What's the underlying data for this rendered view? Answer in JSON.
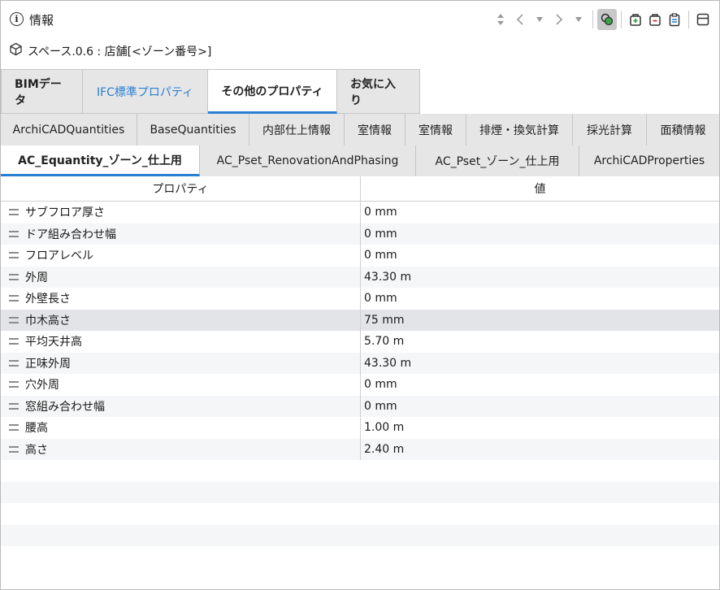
{
  "window": {
    "title": "情報"
  },
  "toolbar": {
    "icons": [
      "up-down-icon",
      "prev-icon",
      "dropdown-icon",
      "next-icon",
      "dropdown-icon",
      "link-settings-icon",
      "add-icon",
      "remove-icon",
      "clipboard-icon",
      "panel-icon"
    ]
  },
  "object": {
    "label": "スペース.0.6 : 店舗[<ゾーン番号>]"
  },
  "tabs_row1": [
    {
      "label": "BIMデータ"
    },
    {
      "label": "IFC標準プロパティ"
    },
    {
      "label": "その他のプロパティ"
    },
    {
      "label": "お気に入り"
    }
  ],
  "tabs_row2": [
    {
      "label": "ArchiCADQuantities"
    },
    {
      "label": "BaseQuantities"
    },
    {
      "label": "内部仕上情報"
    },
    {
      "label": "室情報"
    },
    {
      "label": "室情報"
    },
    {
      "label": "排煙・換気計算"
    },
    {
      "label": "採光計算"
    },
    {
      "label": "面積情報"
    }
  ],
  "tabs_row3": [
    {
      "label": "AC_Equantity_ゾーン_仕上用"
    },
    {
      "label": "AC_Pset_RenovationAndPhasing"
    },
    {
      "label": "AC_Pset_ゾーン_仕上用"
    },
    {
      "label": "ArchiCADProperties"
    }
  ],
  "table": {
    "columns": [
      "プロパティ",
      "値"
    ],
    "rows": [
      {
        "name": "サブフロア厚さ",
        "value": "0 mm"
      },
      {
        "name": "ドア組み合わせ幅",
        "value": "0 mm"
      },
      {
        "name": "フロアレベル",
        "value": "0 mm"
      },
      {
        "name": "外周",
        "value": "43.30 m"
      },
      {
        "name": "外壁長さ",
        "value": "0 mm"
      },
      {
        "name": "巾木高さ",
        "value": "75 mm"
      },
      {
        "name": "平均天井高",
        "value": "5.70 m"
      },
      {
        "name": "正味外周",
        "value": "43.30 m"
      },
      {
        "name": "穴外周",
        "value": "0 mm"
      },
      {
        "name": "窓組み合わせ幅",
        "value": "0 mm"
      },
      {
        "name": "腰高",
        "value": "1.00 m"
      },
      {
        "name": "高さ",
        "value": "2.40 m"
      }
    ]
  },
  "colors": {
    "accent": "#2a7fd2",
    "tab_bg": "#e6e6e6",
    "row_selected": "#e2e4e7"
  }
}
